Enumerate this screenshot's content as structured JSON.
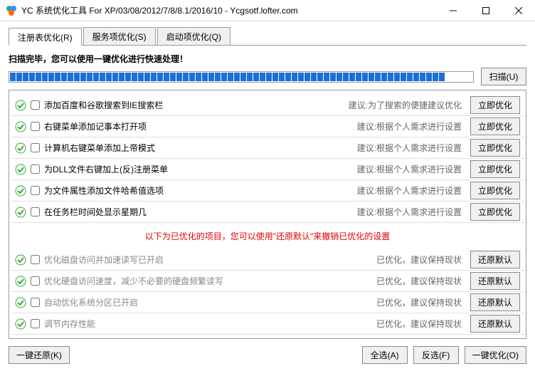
{
  "window": {
    "title": "YC 系统优化工具 For XP/03/08/2012/7/8/8.1/2016/10 - Ycgsotf.lofter.com"
  },
  "tabs": [
    {
      "label": "注册表优化(R)",
      "active": true
    },
    {
      "label": "服务项优化(S)",
      "active": false
    },
    {
      "label": "启动项优化(Q)",
      "active": false
    }
  ],
  "scan": {
    "status_text": "扫描完毕，您可以使用一键优化进行快速处理！",
    "scan_button": "扫描(U)"
  },
  "items": [
    {
      "title": "添加百度和谷歌搜索到IE搜索栏",
      "hint": "建议:为了搜索的便捷建议优化",
      "action": "立即优化",
      "gray": false
    },
    {
      "title": "右键菜单添加记事本打开项",
      "hint": "建议:根据个人需求进行设置",
      "action": "立即优化",
      "gray": false
    },
    {
      "title": "计算机右键菜单添加上帝模式",
      "hint": "建议:根据个人需求进行设置",
      "action": "立即优化",
      "gray": false
    },
    {
      "title": "为DLL文件右键加上(反)注册菜单",
      "hint": "建议:根据个人需求进行设置",
      "action": "立即优化",
      "gray": false
    },
    {
      "title": "为文件属性添加文件哈希值选项",
      "hint": "建议:根据个人需求进行设置",
      "action": "立即优化",
      "gray": false
    },
    {
      "title": "在任务栏时间处显示星期几",
      "hint": "建议:根据个人需求进行设置",
      "action": "立即优化",
      "gray": false
    }
  ],
  "divider": "以下为已优化的项目，您可以使用\"还原默认\"来撤销已优化的设置",
  "optimized_items": [
    {
      "title": "优化磁盘访问并加速读写已开启",
      "hint": "已优化，建议保持现状",
      "action": "还原默认",
      "gray": true
    },
    {
      "title": "优化硬盘访问速度，减少不必要的硬盘频繁读写",
      "hint": "已优化，建议保持现状",
      "action": "还原默认",
      "gray": true
    },
    {
      "title": "自动优化系统分区已开启",
      "hint": "已优化，建议保持现状",
      "action": "还原默认",
      "gray": true
    },
    {
      "title": "调节内存性能",
      "hint": "已优化，建议保持现状",
      "action": "还原默认",
      "gray": true
    }
  ],
  "footer": {
    "restore_all": "一键还原(K)",
    "select_all": "全选(A)",
    "invert": "反选(F)",
    "optimize_all": "一键优化(O)"
  }
}
